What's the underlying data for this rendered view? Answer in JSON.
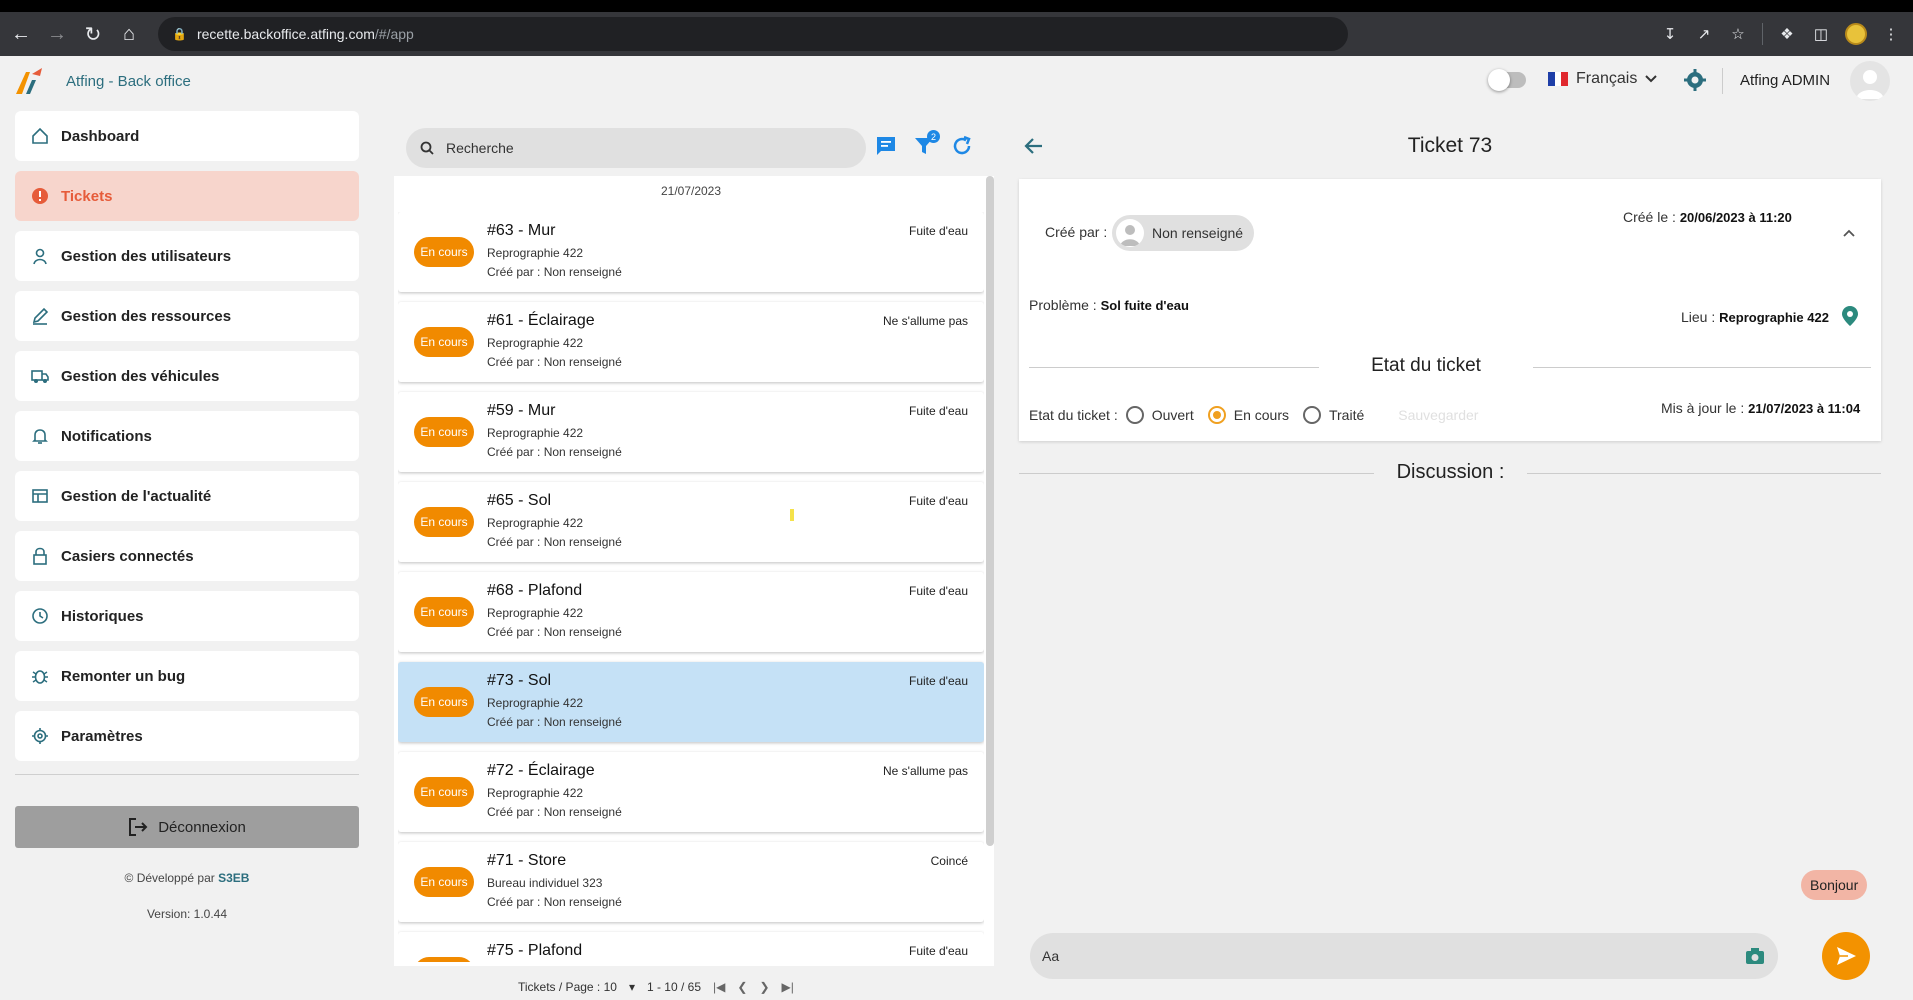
{
  "browser": {
    "url_host": "recette.backoffice.atfing.com",
    "url_path": "/#/app"
  },
  "header": {
    "app_title": "Atfing - Back office",
    "language": "Français",
    "username": "Atfing ADMIN"
  },
  "sidebar": {
    "items": [
      {
        "label": "Dashboard",
        "icon": "home-icon",
        "active": false
      },
      {
        "label": "Tickets",
        "icon": "alert-circle-icon",
        "active": true
      },
      {
        "label": "Gestion des utilisateurs",
        "icon": "user-icon",
        "active": false
      },
      {
        "label": "Gestion des ressources",
        "icon": "pencil-icon",
        "active": false
      },
      {
        "label": "Gestion des véhicules",
        "icon": "truck-icon",
        "active": false
      },
      {
        "label": "Notifications",
        "icon": "bell-icon",
        "active": false
      },
      {
        "label": "Gestion de l'actualité",
        "icon": "newspaper-icon",
        "active": false
      },
      {
        "label": "Casiers connectés",
        "icon": "lock-icon",
        "active": false
      },
      {
        "label": "Historiques",
        "icon": "clock-icon",
        "active": false
      },
      {
        "label": "Remonter un bug",
        "icon": "bug-icon",
        "active": false
      },
      {
        "label": "Paramètres",
        "icon": "settings-icon",
        "active": false
      }
    ],
    "logout_label": "Déconnexion",
    "developed_by": "Développé par",
    "brand": "S3EB",
    "version": "Version: 1.0.44"
  },
  "list": {
    "search_placeholder": "Recherche",
    "filter_count": "2",
    "date": "21/07/2023",
    "tickets": [
      {
        "title": "#63 - Mur",
        "location": "Reprographie 422",
        "creator": "Créé par : Non renseigné",
        "status": "En cours",
        "category": "Fuite d'eau",
        "selected": false
      },
      {
        "title": "#61 - Éclairage",
        "location": "Reprographie 422",
        "creator": "Créé par : Non renseigné",
        "status": "En cours",
        "category": "Ne s'allume pas",
        "selected": false
      },
      {
        "title": "#59 - Mur",
        "location": "Reprographie 422",
        "creator": "Créé par : Non renseigné",
        "status": "En cours",
        "category": "Fuite d'eau",
        "selected": false
      },
      {
        "title": "#65 - Sol",
        "location": "Reprographie 422",
        "creator": "Créé par : Non renseigné",
        "status": "En cours",
        "category": "Fuite d'eau",
        "selected": false
      },
      {
        "title": "#68 - Plafond",
        "location": "Reprographie 422",
        "creator": "Créé par : Non renseigné",
        "status": "En cours",
        "category": "Fuite d'eau",
        "selected": false
      },
      {
        "title": "#73 - Sol",
        "location": "Reprographie 422",
        "creator": "Créé par : Non renseigné",
        "status": "En cours",
        "category": "Fuite d'eau",
        "selected": true
      },
      {
        "title": "#72 - Éclairage",
        "location": "Reprographie 422",
        "creator": "Créé par : Non renseigné",
        "status": "En cours",
        "category": "Ne s'allume pas",
        "selected": false
      },
      {
        "title": "#71 - Store",
        "location": "Bureau individuel 323",
        "creator": "Créé par : Non renseigné",
        "status": "En cours",
        "category": "Coincé",
        "selected": false
      },
      {
        "title": "#75 - Plafond",
        "location": "",
        "creator": "",
        "status": "En cours",
        "category": "Fuite d'eau",
        "selected": false
      }
    ],
    "pagination": {
      "per_page_label": "Tickets / Page : 10",
      "range": "1 - 10 / 65"
    }
  },
  "detail": {
    "title": "Ticket 73",
    "created_by_label": "Créé par :",
    "created_by": "Non renseigné",
    "created_at_label": "Créé le :",
    "created_at": "20/06/2023 à 11:20",
    "problem_label": "Problème :",
    "problem": "Sol fuite d'eau",
    "location_label": "Lieu :",
    "location": "Reprographie 422",
    "state_section": "Etat du ticket",
    "state_label": "Etat du ticket :",
    "states": [
      {
        "label": "Ouvert",
        "checked": false
      },
      {
        "label": "En cours",
        "checked": true
      },
      {
        "label": "Traité",
        "checked": false
      }
    ],
    "save_label": "Sauvegarder",
    "updated_label": "Mis à jour le :",
    "updated_at": "21/07/2023 à 11:04",
    "discussion_title": "Discussion :",
    "messages": [
      {
        "text": "Bonjour"
      }
    ],
    "input_placeholder": "Aa"
  },
  "colors": {
    "accent": "#f18a00",
    "active_bg": "#f7d5cc",
    "active_text": "#e65c3a",
    "teal": "#2c6e7e",
    "selected_row": "#c5e1f6"
  }
}
